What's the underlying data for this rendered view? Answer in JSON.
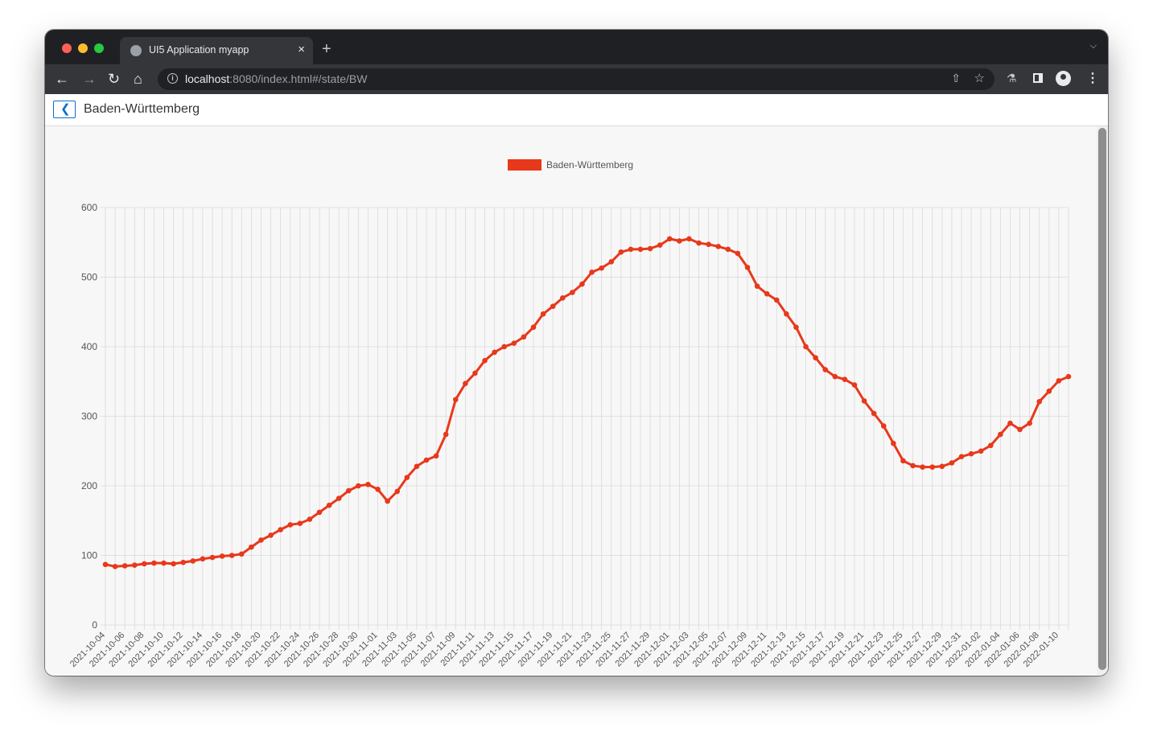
{
  "browser": {
    "tab_title": "UI5 Application myapp",
    "tab_close": "×",
    "new_tab": "+",
    "url_host": "localhost",
    "url_rest": ":8080/index.html#/state/BW"
  },
  "page": {
    "title": "Baden-Württemberg"
  },
  "colors": {
    "series": "#e8381b",
    "grid": "#d9d9d9",
    "tick_text": "#555555"
  },
  "chart_data": {
    "type": "line",
    "title": "",
    "xlabel": "",
    "ylabel": "",
    "ylim": [
      0,
      600
    ],
    "yticks": [
      0,
      100,
      200,
      300,
      400,
      500,
      600
    ],
    "grid": true,
    "legend_position": "top-center",
    "x": [
      "2021-10-04",
      "2021-10-05",
      "2021-10-06",
      "2021-10-07",
      "2021-10-08",
      "2021-10-09",
      "2021-10-10",
      "2021-10-11",
      "2021-10-12",
      "2021-10-13",
      "2021-10-14",
      "2021-10-15",
      "2021-10-16",
      "2021-10-17",
      "2021-10-18",
      "2021-10-19",
      "2021-10-20",
      "2021-10-21",
      "2021-10-22",
      "2021-10-23",
      "2021-10-24",
      "2021-10-25",
      "2021-10-26",
      "2021-10-27",
      "2021-10-28",
      "2021-10-29",
      "2021-10-30",
      "2021-10-31",
      "2021-11-01",
      "2021-11-02",
      "2021-11-03",
      "2021-11-04",
      "2021-11-05",
      "2021-11-06",
      "2021-11-07",
      "2021-11-08",
      "2021-11-09",
      "2021-11-10",
      "2021-11-11",
      "2021-11-12",
      "2021-11-13",
      "2021-11-14",
      "2021-11-15",
      "2021-11-16",
      "2021-11-17",
      "2021-11-18",
      "2021-11-19",
      "2021-11-20",
      "2021-11-21",
      "2021-11-22",
      "2021-11-23",
      "2021-11-24",
      "2021-11-25",
      "2021-11-26",
      "2021-11-27",
      "2021-11-28",
      "2021-11-29",
      "2021-11-30",
      "2021-12-01",
      "2021-12-02",
      "2021-12-03",
      "2021-12-04",
      "2021-12-05",
      "2021-12-06",
      "2021-12-07",
      "2021-12-08",
      "2021-12-09",
      "2021-12-10",
      "2021-12-11",
      "2021-12-12",
      "2021-12-13",
      "2021-12-14",
      "2021-12-15",
      "2021-12-16",
      "2021-12-17",
      "2021-12-18",
      "2021-12-19",
      "2021-12-20",
      "2021-12-21",
      "2021-12-22",
      "2021-12-23",
      "2021-12-24",
      "2021-12-25",
      "2021-12-26",
      "2021-12-27",
      "2021-12-28",
      "2021-12-29",
      "2021-12-30",
      "2021-12-31",
      "2022-01-01",
      "2022-01-02",
      "2022-01-03",
      "2022-01-04",
      "2022-01-05",
      "2022-01-06",
      "2022-01-07",
      "2022-01-08",
      "2022-01-09",
      "2022-01-10",
      "2022-01-11"
    ],
    "x_tick_labels": [
      "2021-10-04",
      "2021-10-06",
      "2021-10-08",
      "2021-10-10",
      "2021-10-12",
      "2021-10-14",
      "2021-10-16",
      "2021-10-18",
      "2021-10-20",
      "2021-10-22",
      "2021-10-24",
      "2021-10-26",
      "2021-10-28",
      "2021-10-30",
      "2021-11-01",
      "2021-11-03",
      "2021-11-05",
      "2021-11-07",
      "2021-11-09",
      "2021-11-11",
      "2021-11-13",
      "2021-11-15",
      "2021-11-17",
      "2021-11-19",
      "2021-11-21",
      "2021-11-23",
      "2021-11-25",
      "2021-11-27",
      "2021-11-29",
      "2021-12-01",
      "2021-12-03",
      "2021-12-05",
      "2021-12-07",
      "2021-12-09",
      "2021-12-11",
      "2021-12-13",
      "2021-12-15",
      "2021-12-17",
      "2021-12-19",
      "2021-12-21",
      "2021-12-23",
      "2021-12-25",
      "2021-12-27",
      "2021-12-29",
      "2021-12-31",
      "2022-01-02",
      "2022-01-04",
      "2022-01-06",
      "2022-01-08",
      "2022-01-10"
    ],
    "series": [
      {
        "name": "Baden-Württemberg",
        "values": [
          87,
          84,
          85,
          86,
          88,
          89,
          89,
          88,
          90,
          92,
          95,
          97,
          99,
          100,
          102,
          112,
          122,
          129,
          137,
          144,
          146,
          152,
          162,
          172,
          182,
          193,
          200,
          202,
          195,
          178,
          192,
          212,
          228,
          237,
          243,
          274,
          324,
          347,
          362,
          380,
          392,
          400,
          405,
          414,
          428,
          447,
          458,
          470,
          478,
          490,
          507,
          513,
          522,
          536,
          540,
          540,
          541,
          546,
          555,
          552,
          555,
          549,
          547,
          544,
          540,
          534,
          514,
          487,
          476,
          467,
          447,
          428,
          400,
          384,
          367,
          357,
          353,
          345,
          322,
          304,
          286,
          261,
          236,
          229,
          227,
          227,
          228,
          233,
          242,
          246,
          250,
          258,
          274,
          290,
          281,
          290,
          321,
          336,
          351,
          357
        ]
      }
    ]
  }
}
